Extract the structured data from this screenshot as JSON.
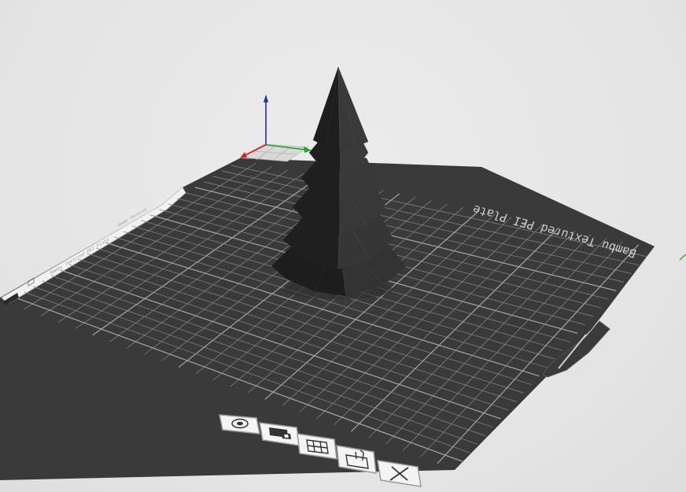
{
  "viewport": {
    "background": "#e6e6e6",
    "build_plate": {
      "label_text": "Bambu Textured PEI Plate",
      "surface_color": "#3a3a3a",
      "grid_color": "#8a8a8a",
      "grid_major_color": "#a6a6a6"
    },
    "side_strip_text": "Bambu Textured PEI Plate",
    "side_strip_text_2": "Bambu Textured",
    "axes": {
      "x_color": "#1fa81f",
      "y_color": "#d81e1e",
      "z_color": "#1c2fbf"
    },
    "model": {
      "name": "christmas-tree",
      "color": "#2a2a2a"
    }
  },
  "plate_toolbar": {
    "buttons": [
      {
        "name": "orient-button",
        "icon": "target-icon"
      },
      {
        "name": "arrange-button",
        "icon": "lock-icon"
      },
      {
        "name": "plate-settings-button",
        "icon": "grid-plate-icon"
      },
      {
        "name": "slice-plate-button",
        "icon": "slice-icon"
      },
      {
        "name": "delete-plate-button",
        "icon": "close-icon"
      }
    ]
  }
}
